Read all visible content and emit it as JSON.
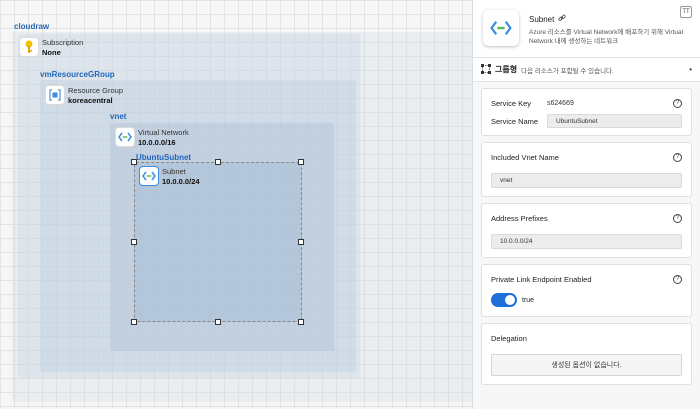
{
  "canvas": {
    "cloud_title": "cloudraw",
    "subscription": {
      "label": "Subscription",
      "value": "None"
    },
    "resource_group_title": "vmResourceGRoup",
    "resource_group": {
      "label": "Resource Group",
      "value": "koreacentral"
    },
    "vnet_title": "vnet",
    "virtual_network": {
      "label": "Virtual Network",
      "value": "10.0.0.0/16"
    },
    "subnet_title": "UbuntuSubnet",
    "subnet": {
      "label": "Subnet",
      "value": "10.0.0.0/24"
    }
  },
  "panel": {
    "title": "Subnet",
    "description": "Azure 리소스를 Virtual Network에 배포하기 위해 Virtual Network 내에 생성하는 네트워크",
    "font_toggle": "TT",
    "group_name": "그룹형",
    "group_desc": "다음 리소스가 포함될 수 있습니다.",
    "group_dot": "•",
    "service_key_label": "Service Key",
    "service_key_value": "s624669",
    "service_name_label": "Service Name",
    "service_name_value": "UbuntuSubnet",
    "vnet_name_label": "Included Vnet Name",
    "vnet_name_value": "vnet",
    "prefixes_label": "Address Prefixes",
    "prefixes_value": "10.0.0.0/24",
    "private_link_label": "Private Link Endpoint Enabled",
    "private_link_value": "true",
    "delegation_label": "Delegation",
    "delegation_empty": "생성된 옵션이 없습니다.",
    "help_glyph": "?"
  },
  "colors": {
    "accent": "#1e6fd9",
    "group_title": "#2366b8"
  }
}
